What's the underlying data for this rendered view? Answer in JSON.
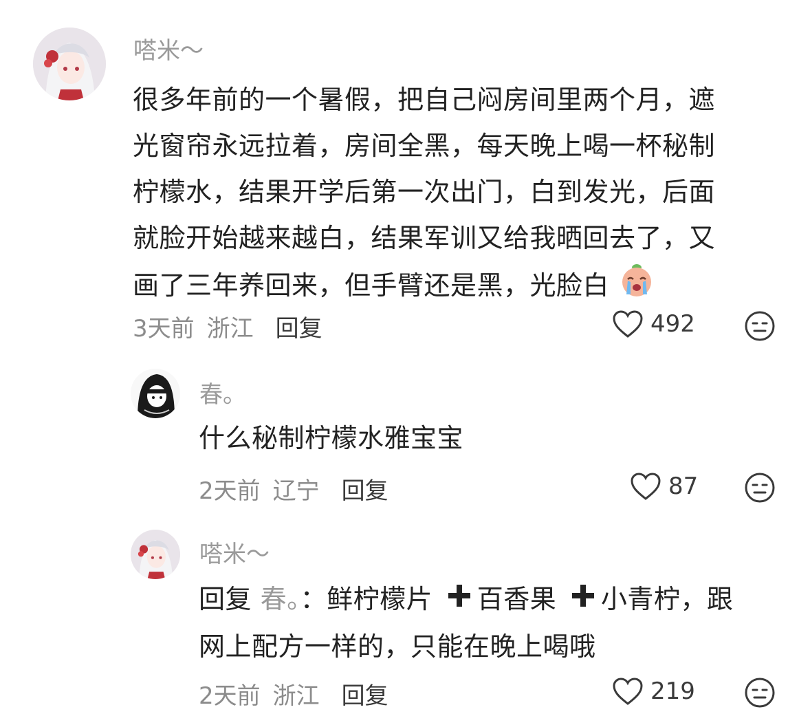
{
  "comments": [
    {
      "user": "嗒米～",
      "lines": [
        "很多年前的一个暑假，把自己闷房间里两个月，遮",
        "光窗帘永远拉着，房间全黑，每天晚上喝一杯秘制",
        "柠檬水，结果开学后第一次出门，白到发光，后面",
        "就脸开始越来越白，结果军训又给我晒回去了，又",
        "画了三年养回来，但手臂还是黑，光脸白"
      ],
      "time": "3天前",
      "location": "浙江",
      "reply_label": "回复",
      "likes": "492",
      "trailing_emoji": "crying-face-emoji"
    },
    {
      "user": "春。",
      "lines": [
        "什么秘制柠檬水雅宝宝"
      ],
      "time": "2天前",
      "location": "辽宁",
      "reply_label": "回复",
      "likes": "87"
    },
    {
      "user": "嗒米～",
      "reply_prefix": "回复",
      "reply_to": "春。",
      "reply_colon": "：",
      "line1_a": "鲜柠檬片",
      "line1_b": "百香果",
      "line1_c": "小青柠，跟",
      "line2": "网上配方一样的，只能在晚上喝哦",
      "time": "2天前",
      "location": "浙江",
      "reply_label": "回复",
      "likes": "219"
    }
  ],
  "colors": {
    "secondary_text": "#9a9a9a",
    "primary_text": "#222222",
    "icon": "#3a3a3a"
  }
}
